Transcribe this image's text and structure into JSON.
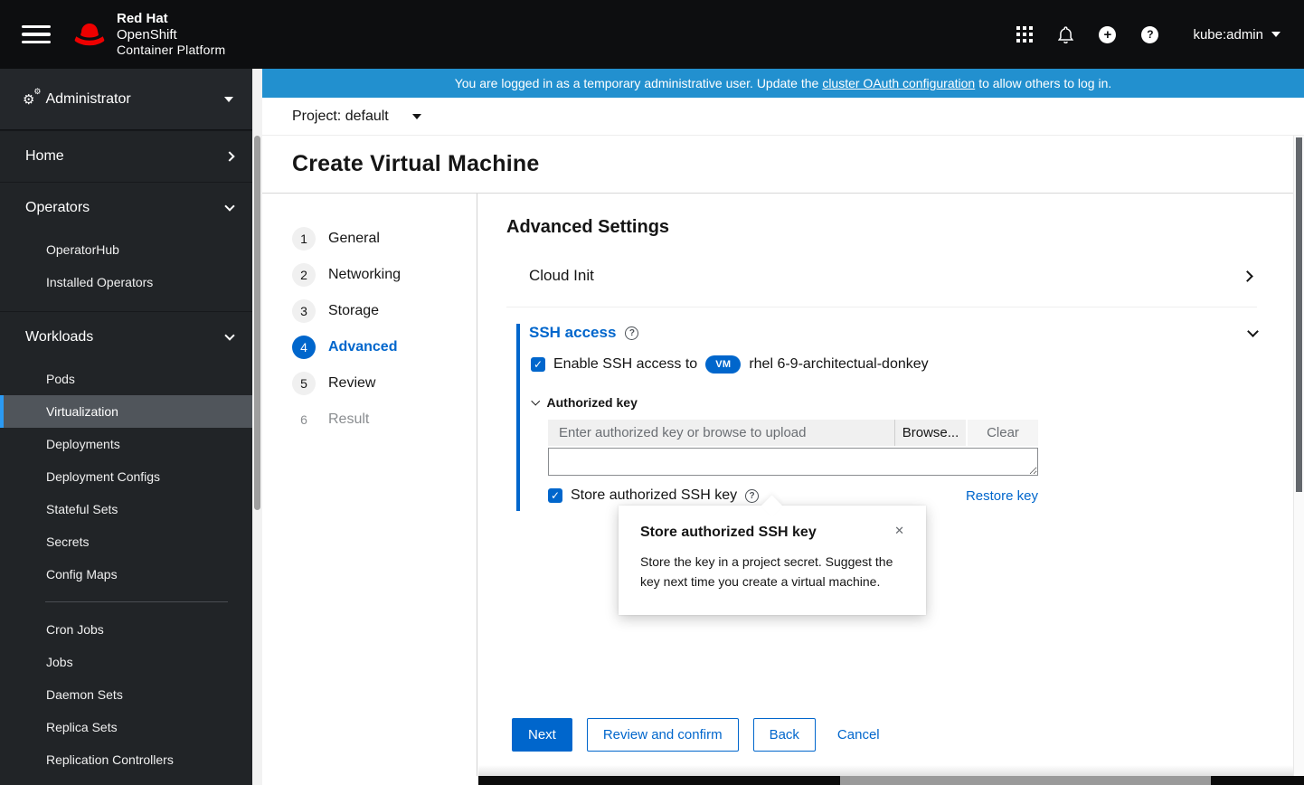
{
  "masthead": {
    "brand_line1": "Red Hat",
    "brand_line2": "OpenShift",
    "brand_line3": "Container Platform",
    "user": "kube:admin"
  },
  "banner": {
    "text_before": "You are logged in as a temporary administrative user. Update the ",
    "link_text": "cluster OAuth configuration",
    "text_after": " to allow others to log in.",
    "bg_color": "#2290cf"
  },
  "project": {
    "label": "Project:",
    "value": "default"
  },
  "page": {
    "title": "Create Virtual Machine"
  },
  "sidebar": {
    "perspective": "Administrator",
    "home": {
      "label": "Home"
    },
    "operators": {
      "label": "Operators",
      "items": [
        "OperatorHub",
        "Installed Operators"
      ]
    },
    "workloads": {
      "label": "Workloads",
      "items": [
        "Pods",
        "Virtualization",
        "Deployments",
        "Deployment Configs",
        "Stateful Sets",
        "Secrets",
        "Config Maps",
        "Cron Jobs",
        "Jobs",
        "Daemon Sets",
        "Replica Sets",
        "Replication Controllers"
      ],
      "selected": "Virtualization"
    }
  },
  "wizard": {
    "steps": [
      {
        "num": "1",
        "label": "General",
        "state": "default"
      },
      {
        "num": "2",
        "label": "Networking",
        "state": "default"
      },
      {
        "num": "3",
        "label": "Storage",
        "state": "default"
      },
      {
        "num": "4",
        "label": "Advanced",
        "state": "current"
      },
      {
        "num": "5",
        "label": "Review",
        "state": "default"
      },
      {
        "num": "6",
        "label": "Result",
        "state": "disabled"
      }
    ]
  },
  "content": {
    "section_title": "Advanced Settings",
    "cloud_init_label": "Cloud Init",
    "ssh": {
      "title": "SSH access",
      "enable_label": "Enable SSH access to",
      "vm_badge": "VM",
      "vm_name": "rhel 6-9-architectual-donkey",
      "enable_checked": true,
      "authorized_key_label": "Authorized key",
      "upload_placeholder": "Enter authorized key or browse to upload",
      "upload_value": "",
      "browse_label": "Browse...",
      "clear_label": "Clear",
      "store_label": "Store authorized SSH key",
      "store_checked": true,
      "restore_link": "Restore key"
    },
    "popover": {
      "title": "Store authorized SSH key",
      "body": "Store the key in a project secret. Suggest the key next time you create a virtual machine."
    },
    "footer": {
      "next": "Next",
      "review": "Review and confirm",
      "back": "Back",
      "cancel": "Cancel"
    }
  },
  "colors": {
    "accent": "#0066cc",
    "banner": "#2290cf",
    "selected_nav_bar": "#2b9af3",
    "masthead": "#0d0e10",
    "sidebar": "#212427"
  }
}
